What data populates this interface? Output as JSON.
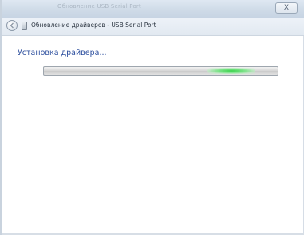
{
  "window": {
    "faded_title": "Обновление USB Serial Port",
    "close_label": "X"
  },
  "header": {
    "title": "Обновление драйверов - USB Serial Port"
  },
  "content": {
    "status": "Установка драйвера..."
  },
  "progress": {
    "mode": "indeterminate",
    "indicator_color": "#39d24a"
  },
  "icons": [
    "back-arrow-icon",
    "usb-device-icon",
    "close-icon"
  ]
}
